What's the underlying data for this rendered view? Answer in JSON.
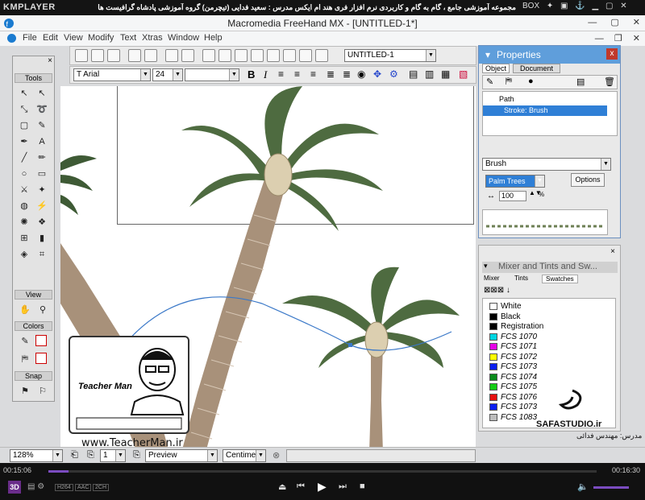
{
  "kmplayer": {
    "logo": "KMPLAYER",
    "title": "مجموعه آموزشی جامع ، گام به گام و کاربردی نرم افزار فری هند ام ایکس  مدرس : سعید فدایی (تیچرمن) گروه آموزشی پادشاه گرافیست ها",
    "box_label": "BOX"
  },
  "app": {
    "title": "Macromedia FreeHand MX - [UNTITLED-1*]",
    "menu": [
      "File",
      "Edit",
      "View",
      "Modify",
      "Text",
      "Xtras",
      "Window",
      "Help"
    ],
    "doc_select": "UNTITLED-1",
    "font_name": "Arial",
    "font_size": "24"
  },
  "tools": {
    "title": "Tools",
    "view_title": "View",
    "colors_title": "Colors",
    "snap_title": "Snap"
  },
  "properties": {
    "title": "Properties",
    "tabs": [
      "Object",
      "Document"
    ],
    "tree": [
      "Path",
      "Stroke: Brush"
    ],
    "stroke_type": "Brush",
    "brush_name": "Palm Trees",
    "options_label": "Options",
    "scale_value": "100",
    "scale_unit": "%"
  },
  "mixer": {
    "title": "Mixer and Tints and Sw...",
    "tabs": [
      "Mixer",
      "Tints",
      "Swatches"
    ],
    "swatches": [
      {
        "name": "White",
        "color": "#ffffff"
      },
      {
        "name": "Black",
        "color": "#000000"
      },
      {
        "name": "Registration",
        "color": "#000000"
      },
      {
        "name": "FCS 1070",
        "color": "#00d5e0"
      },
      {
        "name": "FCS 1071",
        "color": "#e600e6"
      },
      {
        "name": "FCS 1072",
        "color": "#ffff00"
      },
      {
        "name": "FCS 1073",
        "color": "#0a1ef0"
      },
      {
        "name": "FCS 1074",
        "color": "#0a8a1a"
      },
      {
        "name": "FCS 1075",
        "color": "#14cc14"
      },
      {
        "name": "FCS 1076",
        "color": "#e61010"
      },
      {
        "name": "FCS 1073",
        "color": "#0a1ef0"
      },
      {
        "name": "FCS 1083",
        "color": "#bdbdbd"
      }
    ]
  },
  "status": {
    "zoom": "128%",
    "page": "1",
    "view_mode": "Preview",
    "units": "Centimeter"
  },
  "player": {
    "time_elapsed": "00:15:06",
    "time_total": "00:16:30",
    "badges": [
      "H264",
      "AAC",
      "2CH"
    ]
  },
  "watermark": {
    "url": "www.TeacherMan.ir",
    "name": "Teacher Man",
    "studio": "SAFASTUDIO.ir",
    "teacher": "مدرس: مهندس فدائی"
  }
}
